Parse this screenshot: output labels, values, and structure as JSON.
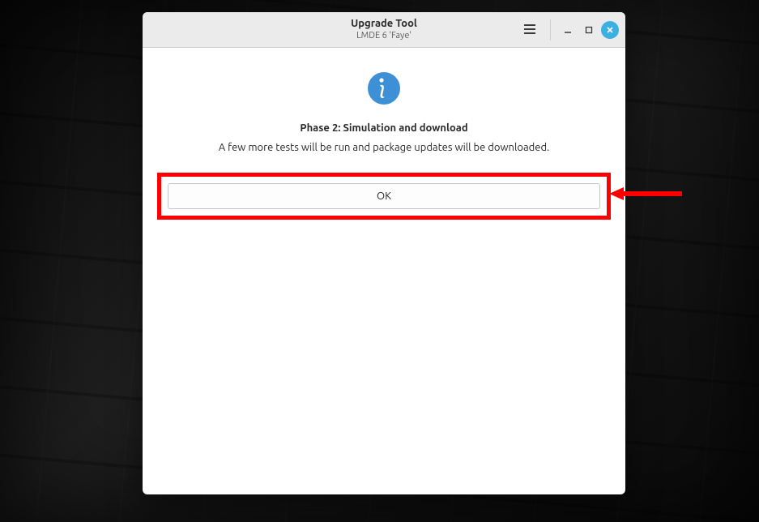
{
  "window": {
    "title": "Upgrade Tool",
    "subtitle": "LMDE 6 'Faye'"
  },
  "dialog": {
    "heading": "Phase 2: Simulation and download",
    "description": "A few more tests will be run and package updates will be downloaded.",
    "ok_label": "OK"
  },
  "icons": {
    "info": "info-icon",
    "hamburger": "hamburger-icon",
    "minimize": "minimize-icon",
    "maximize": "maximize-icon",
    "close": "close-icon"
  },
  "colors": {
    "accent": "#3d8fd6",
    "close_button": "#3db0e2",
    "annotation": "#ff0000"
  }
}
